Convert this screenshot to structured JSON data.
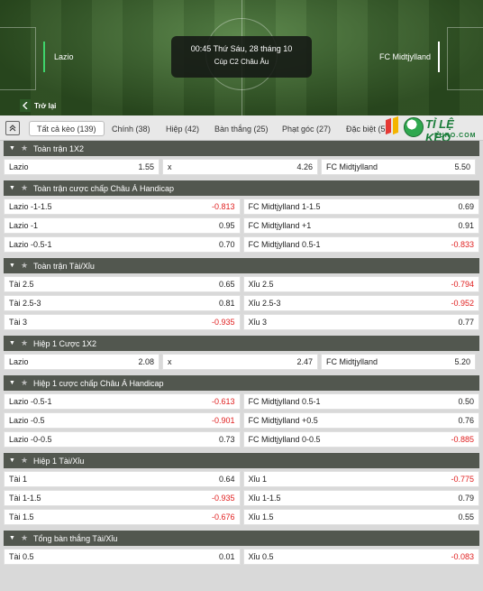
{
  "match": {
    "home_team": "Lazio",
    "away_team": "FC Midtjylland",
    "datetime": "00:45 Thứ Sáu, 28 tháng 10",
    "competition": "Cúp C2 Châu Âu",
    "back_label": "Trở lại"
  },
  "tabs": [
    {
      "label": "Tất cả kèo (139)"
    },
    {
      "label": "Chính (38)"
    },
    {
      "label": "Hiệp (42)"
    },
    {
      "label": "Bàn thắng (25)"
    },
    {
      "label": "Phạt góc (27)"
    },
    {
      "label": "Đặc biệt (5)"
    }
  ],
  "logo": {
    "brand": "TỈ LỆ KÈO",
    "sub": "EURO.COM"
  },
  "colors": {
    "negative": "#e02020",
    "header_bg": "#52574f",
    "accent_green": "#3fd46b"
  },
  "markets": [
    {
      "title": "Toàn trận 1X2",
      "layout": "three",
      "rows": [
        [
          {
            "label": "Lazio",
            "odd": "1.55"
          },
          {
            "label": "x",
            "odd": "4.26"
          },
          {
            "label": "FC Midtjylland",
            "odd": "5.50"
          }
        ]
      ]
    },
    {
      "title": "Toàn trận cược chấp Châu Á Handicap",
      "layout": "two",
      "rows": [
        [
          {
            "label": "Lazio -1-1.5",
            "odd": "-0.813"
          },
          {
            "label": "FC Midtjylland 1-1.5",
            "odd": "0.69"
          }
        ],
        [
          {
            "label": "Lazio -1",
            "odd": "0.95"
          },
          {
            "label": "FC Midtjylland +1",
            "odd": "0.91"
          }
        ],
        [
          {
            "label": "Lazio -0.5-1",
            "odd": "0.70"
          },
          {
            "label": "FC Midtjylland 0.5-1",
            "odd": "-0.833"
          }
        ]
      ]
    },
    {
      "title": "Toàn trận Tài/Xỉu",
      "layout": "two",
      "rows": [
        [
          {
            "label": "Tài 2.5",
            "odd": "0.65"
          },
          {
            "label": "Xỉu 2.5",
            "odd": "-0.794"
          }
        ],
        [
          {
            "label": "Tài 2.5-3",
            "odd": "0.81"
          },
          {
            "label": "Xỉu 2.5-3",
            "odd": "-0.952"
          }
        ],
        [
          {
            "label": "Tài 3",
            "odd": "-0.935"
          },
          {
            "label": "Xỉu 3",
            "odd": "0.77"
          }
        ]
      ]
    },
    {
      "title": "Hiệp 1 Cược 1X2",
      "layout": "three",
      "rows": [
        [
          {
            "label": "Lazio",
            "odd": "2.08"
          },
          {
            "label": "x",
            "odd": "2.47"
          },
          {
            "label": "FC Midtjylland",
            "odd": "5.20"
          }
        ]
      ]
    },
    {
      "title": "Hiệp 1 cược chấp Châu Á Handicap",
      "layout": "two",
      "rows": [
        [
          {
            "label": "Lazio -0.5-1",
            "odd": "-0.613"
          },
          {
            "label": "FC Midtjylland 0.5-1",
            "odd": "0.50"
          }
        ],
        [
          {
            "label": "Lazio -0.5",
            "odd": "-0.901"
          },
          {
            "label": "FC Midtjylland +0.5",
            "odd": "0.76"
          }
        ],
        [
          {
            "label": "Lazio -0-0.5",
            "odd": "0.73"
          },
          {
            "label": "FC Midtjylland 0-0.5",
            "odd": "-0.885"
          }
        ]
      ]
    },
    {
      "title": "Hiệp 1 Tài/Xỉu",
      "layout": "two",
      "rows": [
        [
          {
            "label": "Tài 1",
            "odd": "0.64"
          },
          {
            "label": "Xỉu 1",
            "odd": "-0.775"
          }
        ],
        [
          {
            "label": "Tài 1-1.5",
            "odd": "-0.935"
          },
          {
            "label": "Xỉu 1-1.5",
            "odd": "0.79"
          }
        ],
        [
          {
            "label": "Tài 1.5",
            "odd": "-0.676"
          },
          {
            "label": "Xỉu 1.5",
            "odd": "0.55"
          }
        ]
      ]
    },
    {
      "title": "Tổng bàn thắng Tài/Xỉu",
      "layout": "two",
      "rows": [
        [
          {
            "label": "Tài 0.5",
            "odd": "0.01"
          },
          {
            "label": "Xỉu 0.5",
            "odd": "-0.083"
          }
        ]
      ]
    }
  ]
}
